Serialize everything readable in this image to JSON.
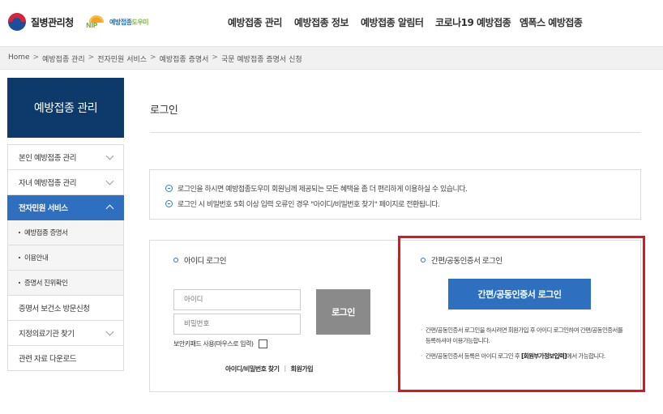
{
  "header": {
    "kdca_logo_text": "질병관리청",
    "nip_logo_letters": "NIP",
    "nip_logo_text_a": "예방접종",
    "nip_logo_text_b": "도우미",
    "nav": [
      "예방접종 관리",
      "예방접종 정보",
      "예방접종 알림터",
      "코로나19 예방접종",
      "엠폭스 예방접종"
    ]
  },
  "breadcrumb": [
    "Home",
    "예방접종 관리",
    "전자민원 서비스",
    "예방접종 증명서",
    "국문 예방접종 증명서 신청"
  ],
  "breadcrumb_separator": ">",
  "sidebar": {
    "title": "예방접종 관리",
    "items": [
      {
        "label": "본인 예방접종 관리"
      },
      {
        "label": "자녀 예방접종 관리"
      },
      {
        "label": "전자민원 서비스"
      },
      {
        "label": "예방접종 증명서"
      },
      {
        "label": "이용안내"
      },
      {
        "label": "증명서 진위확인"
      },
      {
        "label": "증명서 보건소 방문신청"
      },
      {
        "label": "지정의료기관 찾기"
      },
      {
        "label": "관련 자료 다운로드"
      }
    ],
    "active_color": "#2e6fbf",
    "title_bg": "#0d3a6b"
  },
  "main": {
    "title": "로그인",
    "notices": [
      "로그인을 하시면 예방접종도우미 회원님께 제공되는 모든 혜택을 좀 더 편리하게 이용하실 수 있습니다.",
      "로그인 시 비밀번호 5회 이상 입력 오류인 경우 \"아이디/비밀번호 찾기\" 페이지로 전환됩니다."
    ],
    "id_login": {
      "title": "아이디 로그인",
      "id_placeholder": "아이디",
      "pw_placeholder": "비밀번호",
      "login_button": "로그인",
      "security_label": "보안키패드 사용(마우스로 입력)",
      "find_link": "아이디/비밀번호 찾기",
      "link_separator": "|",
      "join_link": "회원가입"
    },
    "cert_login": {
      "title": "간편/공동인증서 로그인",
      "button": "간편/공동인증서 로그인",
      "note1": "간편/공동인증서 로그인을 하시려면 회원가입 후 아이디 로그인하여 간편/공동인증서를 등록하셔야 이용가능합니다.",
      "note2_a": "간편/공동인증서 등록은 아이디 로그인 후 ",
      "note2_b": "[회원부가정보입력]",
      "note2_c": "에서 가능합니다."
    }
  },
  "colors": {
    "primary_button": "#2e6fbf",
    "gray_button": "#8a8a8a",
    "highlight_border": "#e1141e"
  }
}
